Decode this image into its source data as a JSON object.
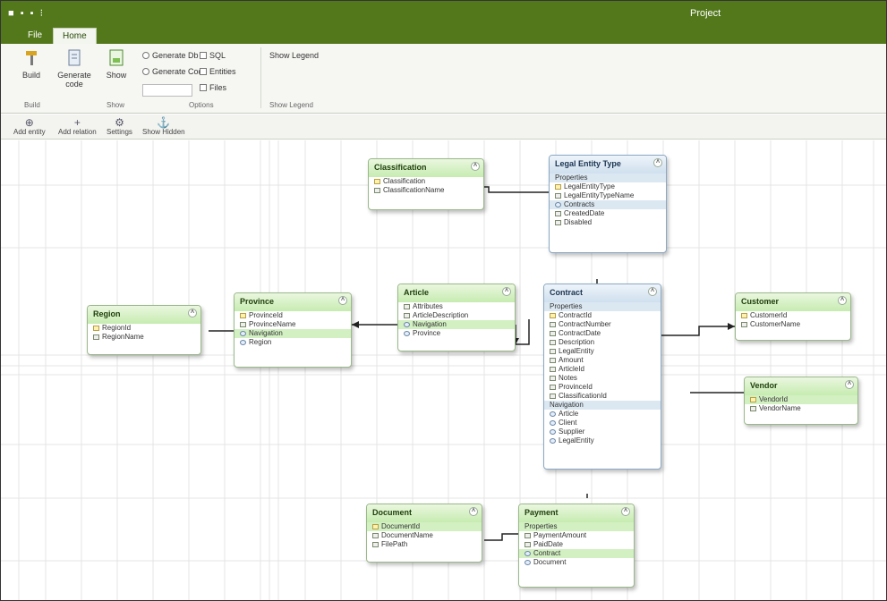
{
  "window": {
    "qat": "■ ▪ ▪  ⁝",
    "title": "Project"
  },
  "ribbon": {
    "tabs": [
      "File",
      "Home"
    ],
    "buttons": [
      {
        "name": "build-button",
        "label": "Build"
      },
      {
        "name": "generate-button",
        "label": "Generate code"
      },
      {
        "name": "show-button",
        "label": "Show"
      }
    ],
    "radios": [
      "Generate Db",
      "Generate Code"
    ],
    "checks": [
      "SQL",
      "Entities",
      "Files"
    ],
    "right_option": "Show Legend",
    "groups": [
      "Build",
      "Show",
      "Options",
      "Show Legend"
    ]
  },
  "toolbar": {
    "items": [
      {
        "glyph": "⊕",
        "label": "Add entity"
      },
      {
        "glyph": "+",
        "label": "Add relation"
      },
      {
        "glyph": "⚙",
        "label": "Settings"
      },
      {
        "glyph": "⚓",
        "label": "Show Hidden"
      }
    ]
  },
  "entities": [
    {
      "id": "classification",
      "title": "Classification",
      "theme": "green",
      "rows": [
        {
          "label": "Classification",
          "kind": "key",
          "hl": false
        },
        {
          "label": "ClassificationName",
          "kind": "field",
          "hl": false
        }
      ]
    },
    {
      "id": "legal-entity",
      "title": "Legal Entity Type",
      "theme": "blue",
      "rows": [
        {
          "label": "Properties",
          "kind": "field",
          "hl": true
        },
        {
          "label": "LegalEntityType",
          "kind": "key",
          "hl": false
        },
        {
          "label": "LegalEntityTypeName",
          "kind": "field",
          "hl": false
        },
        {
          "label": "Contracts",
          "kind": "nav",
          "hl": true
        },
        {
          "label": "CreatedDate",
          "kind": "field",
          "hl": false
        },
        {
          "label": "Disabled",
          "kind": "field",
          "hl": false
        }
      ]
    },
    {
      "id": "region",
      "title": "Region",
      "theme": "green",
      "rows": [
        {
          "label": "RegionId",
          "kind": "key",
          "hl": false
        },
        {
          "label": "RegionName",
          "kind": "field",
          "hl": false
        }
      ]
    },
    {
      "id": "province",
      "title": "Province",
      "theme": "green",
      "rows": [
        {
          "label": "ProvinceId",
          "kind": "key",
          "hl": false
        },
        {
          "label": "ProvinceName",
          "kind": "field",
          "hl": false
        },
        {
          "label": "Navigation",
          "kind": "nav",
          "hl": true
        },
        {
          "label": "Region",
          "kind": "nav",
          "hl": false
        }
      ]
    },
    {
      "id": "article",
      "title": "Article",
      "theme": "green",
      "rows": [
        {
          "label": "Attributes",
          "kind": "field",
          "hl": false
        },
        {
          "label": "ArticleDescription",
          "kind": "field",
          "hl": false
        },
        {
          "label": "Navigation",
          "kind": "nav",
          "hl": true
        },
        {
          "label": "Province",
          "kind": "nav",
          "hl": false
        }
      ]
    },
    {
      "id": "contract",
      "title": "Contract",
      "theme": "blue",
      "rows": [
        {
          "label": "Properties",
          "kind": "field",
          "hl": true
        },
        {
          "label": "ContractId",
          "kind": "key",
          "hl": false
        },
        {
          "label": "ContractNumber",
          "kind": "field",
          "hl": false
        },
        {
          "label": "ContractDate",
          "kind": "field",
          "hl": false
        },
        {
          "label": "Description",
          "kind": "field",
          "hl": false
        },
        {
          "label": "LegalEntity",
          "kind": "field",
          "hl": false
        },
        {
          "label": "Amount",
          "kind": "field",
          "hl": false
        },
        {
          "label": "ArticleId",
          "kind": "field",
          "hl": false
        },
        {
          "label": "Notes",
          "kind": "field",
          "hl": false
        },
        {
          "label": "ProvinceId",
          "kind": "field",
          "hl": false
        },
        {
          "label": "ClassificationId",
          "kind": "field",
          "hl": false
        },
        {
          "label": "Navigation",
          "kind": "nav",
          "hl": true
        },
        {
          "label": "Article",
          "kind": "nav",
          "hl": false
        },
        {
          "label": "Client",
          "kind": "nav",
          "hl": false
        },
        {
          "label": "Supplier",
          "kind": "nav",
          "hl": false
        },
        {
          "label": "LegalEntity",
          "kind": "nav",
          "hl": false
        }
      ]
    },
    {
      "id": "customer",
      "title": "Customer",
      "theme": "green",
      "rows": [
        {
          "label": "CustomerId",
          "kind": "key",
          "hl": false
        },
        {
          "label": "CustomerName",
          "kind": "field",
          "hl": false
        }
      ]
    },
    {
      "id": "vendor",
      "title": "Vendor",
      "theme": "green",
      "rows": [
        {
          "label": "VendorId",
          "kind": "key",
          "hl": false
        },
        {
          "label": "VendorName",
          "kind": "field",
          "hl": false
        }
      ]
    },
    {
      "id": "document",
      "title": "Document",
      "theme": "green",
      "rows": [
        {
          "label": "DocumentId",
          "kind": "key",
          "hl": true
        },
        {
          "label": "DocumentName",
          "kind": "field",
          "hl": false
        },
        {
          "label": "FilePath",
          "kind": "field",
          "hl": false
        }
      ]
    },
    {
      "id": "payment",
      "title": "Payment",
      "theme": "green",
      "rows": [
        {
          "label": "Properties",
          "kind": "field",
          "hl": true
        },
        {
          "label": "PaymentAmount",
          "kind": "field",
          "hl": false
        },
        {
          "label": "PaidDate",
          "kind": "field",
          "hl": false
        },
        {
          "label": "Contract",
          "kind": "nav",
          "hl": true
        },
        {
          "label": "Document",
          "kind": "nav",
          "hl": false
        }
      ]
    }
  ]
}
